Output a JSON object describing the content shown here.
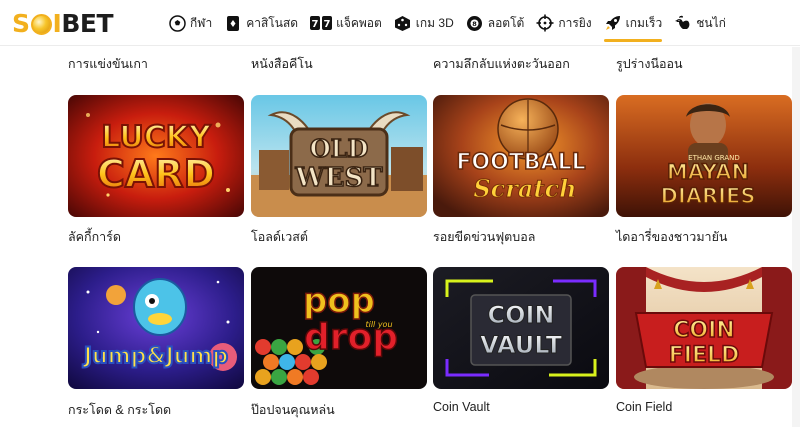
{
  "brand": {
    "part1": "S",
    "part2": "I",
    "part3": "BET"
  },
  "nav": [
    {
      "label": "กีฬา",
      "icon": "soccer-ball-icon"
    },
    {
      "label": "คาสิโนสด",
      "icon": "playing-card-icon"
    },
    {
      "label": "แจ็คพอต",
      "icon": "jackpot-777-icon"
    },
    {
      "label": "เกม 3D",
      "icon": "dice-icon"
    },
    {
      "label": "ลอตโต้",
      "icon": "lotto-ball-icon"
    },
    {
      "label": "การยิง",
      "icon": "crosshair-icon"
    },
    {
      "label": "เกมเร็ว",
      "icon": "rocket-icon",
      "active": true
    },
    {
      "label": "ชนไก่",
      "icon": "rooster-icon"
    }
  ],
  "prev_row_labels": [
    "การแข่งขันเกา",
    "หนังสือคีโน",
    "ความลึกลับแห่งตะวันออก",
    "รูปร่างนีออน"
  ],
  "games": [
    {
      "title": "ลัคกี้การ์ด",
      "art_text_1": "LUCKY",
      "art_text_2": "CARD"
    },
    {
      "title": "โอลด์เวสต์",
      "art_text_1": "OLD",
      "art_text_2": "WEST"
    },
    {
      "title": "รอยขีดข่วนฟุตบอล",
      "art_text_1": "FOOTBALL",
      "art_text_2": "Scratch"
    },
    {
      "title": "ไดอารี่ของชาวมายัน",
      "art_text_1": "MAYAN",
      "art_text_2": "DIARIES",
      "art_text_3": "ETHAN GRAND"
    },
    {
      "title": "กระโดด & กระโดด",
      "art_text_1": "Jump&Jump"
    },
    {
      "title": "ป๊อปจนคุณหล่น",
      "art_text_1": "pop",
      "art_text_2": "drop",
      "art_text_3": "till you"
    },
    {
      "title": "Coin Vault",
      "art_text_1": "COIN",
      "art_text_2": "VAULT"
    },
    {
      "title": "Coin Field",
      "art_text_1": "COIN",
      "art_text_2": "FIELD"
    }
  ],
  "colors": {
    "accent": "#f2b01e",
    "text": "#202020"
  }
}
